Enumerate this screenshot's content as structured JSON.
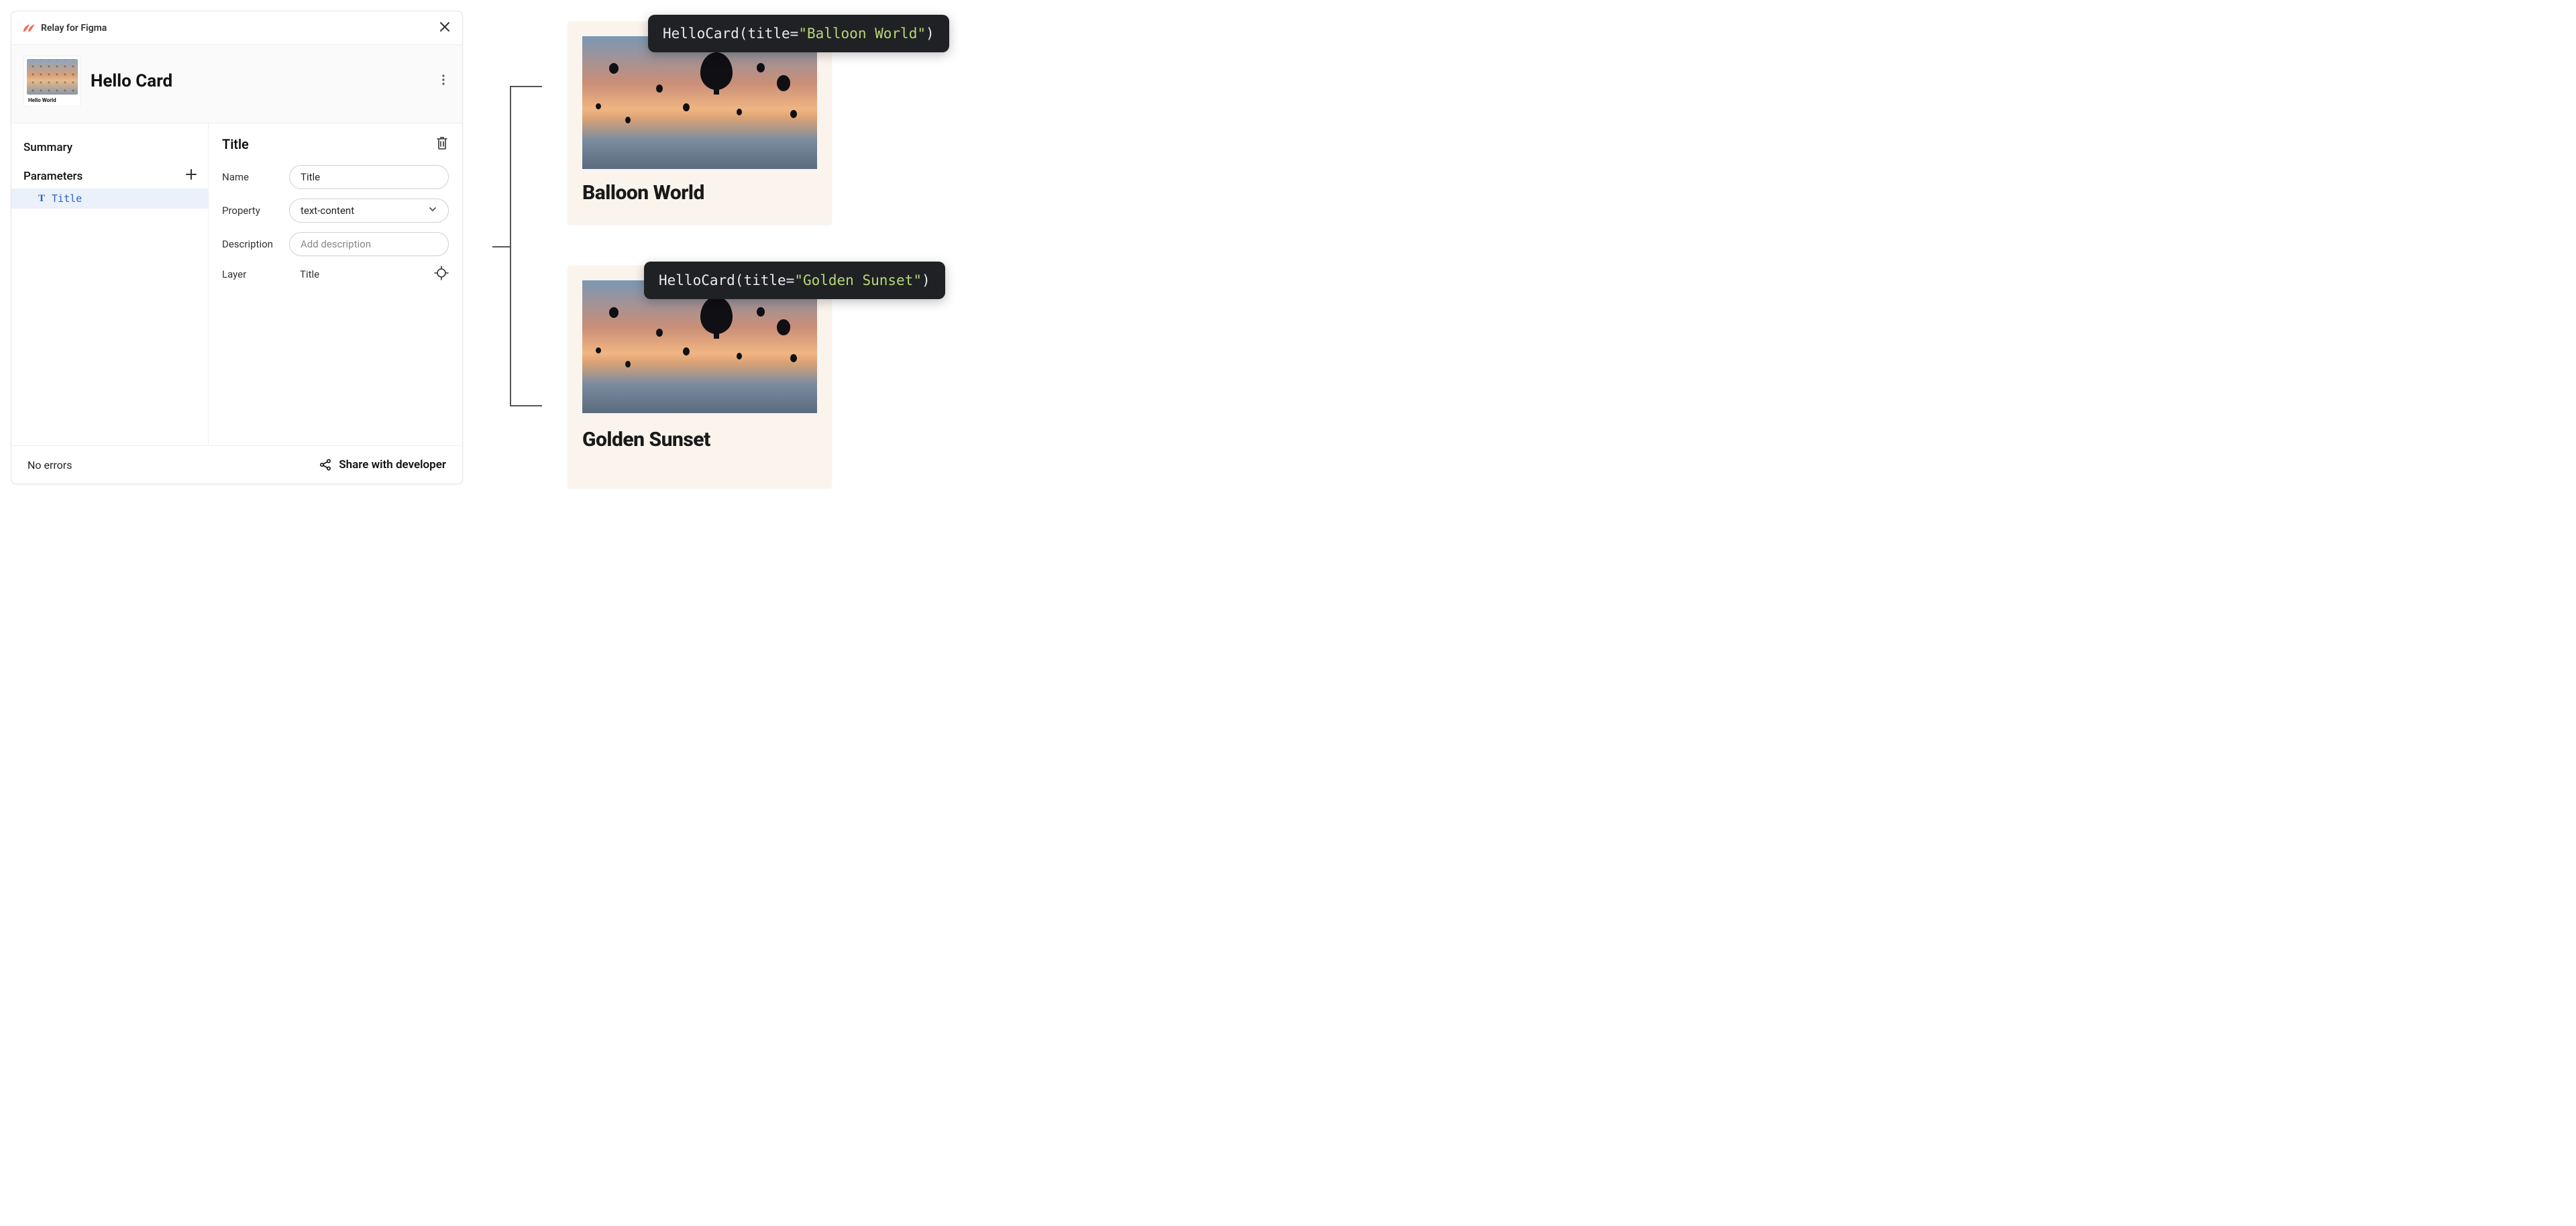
{
  "plugin": {
    "name": "Relay for Figma"
  },
  "component": {
    "name": "Hello Card",
    "thumb_text": "Hello World"
  },
  "sidebar": {
    "summary": "Summary",
    "parameters": "Parameters",
    "items": [
      {
        "label": "Title"
      }
    ]
  },
  "detail": {
    "heading": "Title",
    "fields": {
      "name": {
        "label": "Name",
        "value": "Title"
      },
      "property": {
        "label": "Property",
        "value": "text-content"
      },
      "description": {
        "label": "Description",
        "placeholder": "Add description"
      },
      "layer": {
        "label": "Layer",
        "value": "Title"
      }
    }
  },
  "footer": {
    "errors": "No errors",
    "share": "Share with developer"
  },
  "previews": [
    {
      "caption": "Balloon World",
      "code_fn": "HelloCard",
      "code_param": "title",
      "code_value": "\"Balloon World\""
    },
    {
      "caption": "Golden Sunset",
      "code_fn": "HelloCard",
      "code_param": "title",
      "code_value": "\"Golden Sunset\""
    }
  ]
}
